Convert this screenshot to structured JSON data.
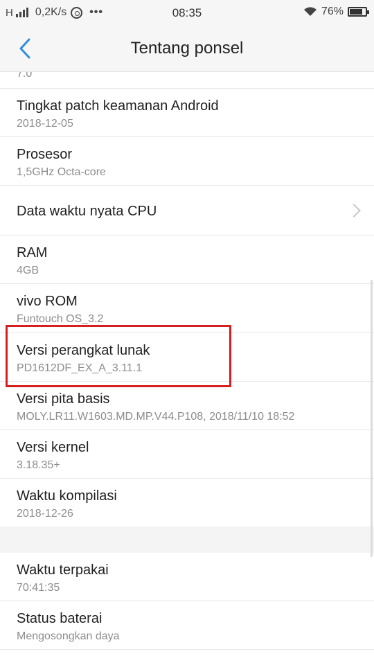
{
  "status_bar": {
    "network": "H",
    "speed": "0,2K/s",
    "more": "•••",
    "time": "08:35",
    "battery": "76%",
    "battery_level": 0.76
  },
  "header": {
    "title": "Tentang ponsel",
    "back_icon": "chevron-left-icon"
  },
  "list": {
    "clipped_value": "7.0",
    "items": [
      {
        "title": "Tingkat patch keamanan Android",
        "subtitle": "2018-12-05"
      },
      {
        "title": "Prosesor",
        "subtitle": "1,5GHz Octa-core"
      },
      {
        "title": "Data waktu nyata CPU",
        "subtitle": ""
      },
      {
        "title": "RAM",
        "subtitle": "4GB"
      },
      {
        "title": "vivo ROM",
        "subtitle": "Funtouch OS_3.2"
      },
      {
        "title": "Versi perangkat lunak",
        "subtitle": "PD1612DF_EX_A_3.11.1"
      },
      {
        "title": "Versi pita basis",
        "subtitle": "MOLY.LR11.W1603.MD.MP.V44.P108, 2018/11/10 18:52"
      },
      {
        "title": "Versi kernel",
        "subtitle": "3.18.35+"
      },
      {
        "title": "Waktu kompilasi",
        "subtitle": "2018-12-26"
      }
    ],
    "items2": [
      {
        "title": "Waktu terpakai",
        "subtitle": "70:41:35"
      },
      {
        "title": "Status baterai",
        "subtitle": "Mengosongkan daya"
      }
    ]
  },
  "colors": {
    "highlight": "#d62020",
    "accent": "#2f8fdc"
  }
}
